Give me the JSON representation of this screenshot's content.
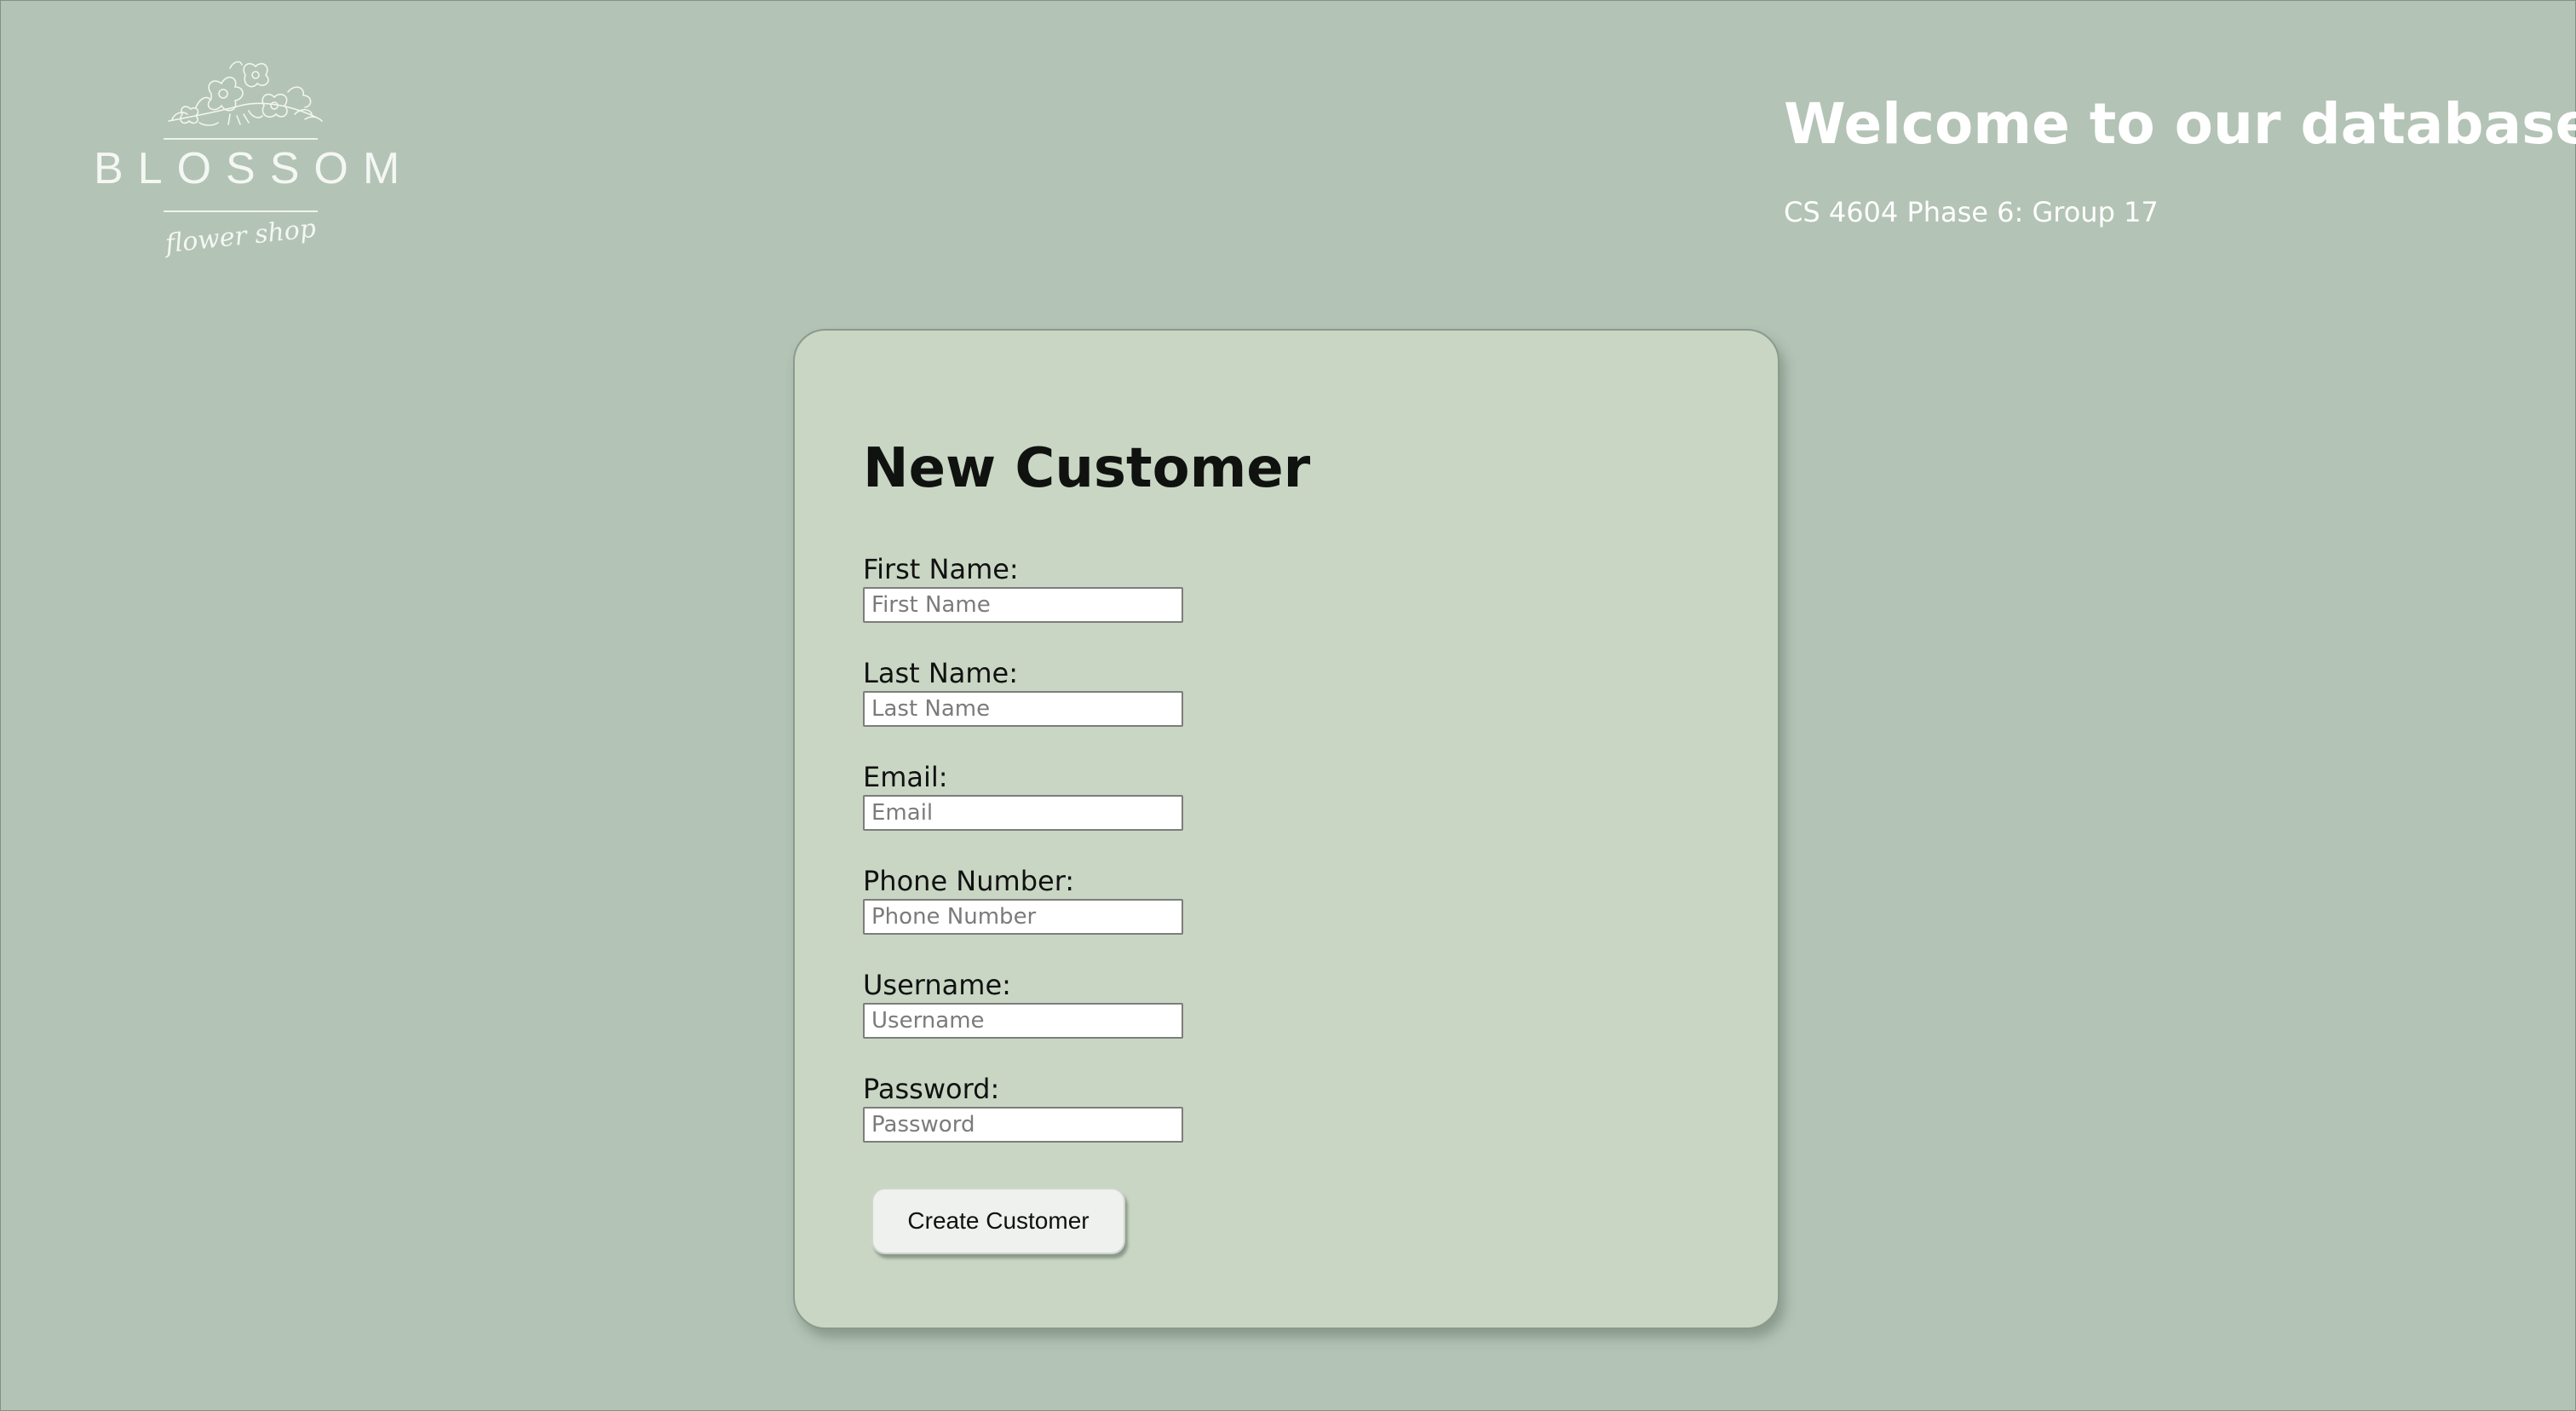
{
  "logo": {
    "name": "BLOSSOM",
    "tagline": "flower shop"
  },
  "header": {
    "welcome": "Welcome to our database!",
    "subtitle": "CS 4604 Phase 6: Group 17"
  },
  "form": {
    "title": "New Customer",
    "fields": [
      {
        "label": "First Name:",
        "placeholder": "First Name",
        "value": ""
      },
      {
        "label": "Last Name:",
        "placeholder": "Last Name",
        "value": ""
      },
      {
        "label": "Email:",
        "placeholder": "Email",
        "value": ""
      },
      {
        "label": "Phone Number:",
        "placeholder": "Phone Number",
        "value": ""
      },
      {
        "label": "Username:",
        "placeholder": "Username",
        "value": ""
      },
      {
        "label": "Password:",
        "placeholder": "Password",
        "value": ""
      }
    ],
    "submit_label": "Create Customer"
  },
  "colors": {
    "background": "#b3c3b5",
    "card": "#c9d6c4",
    "header_text": "#ffffff",
    "button": "#eef1ed"
  },
  "icons": {
    "logo_illustration": "flower-branch-icon"
  }
}
